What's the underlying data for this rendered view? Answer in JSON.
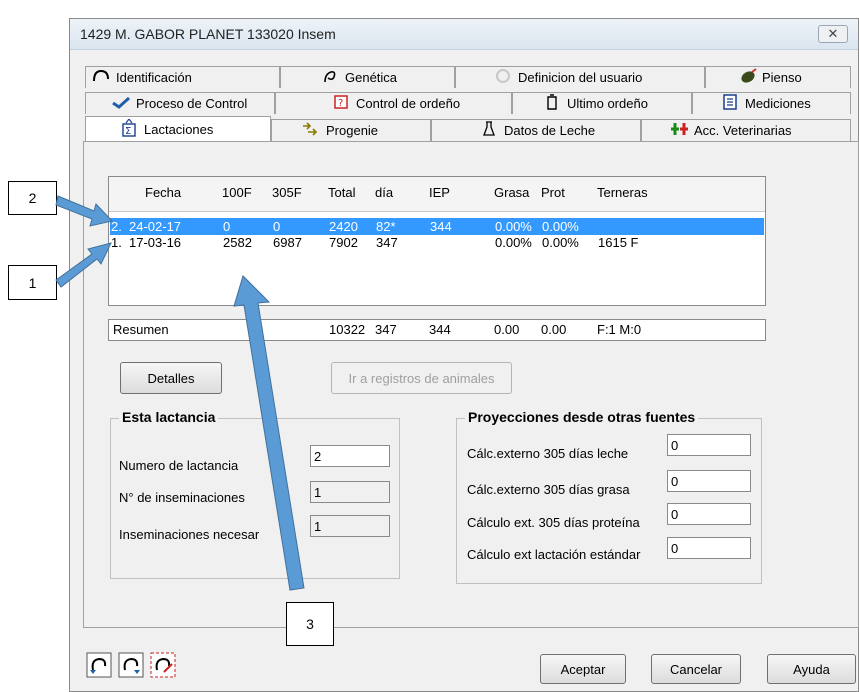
{
  "window": {
    "title": "1429  M. GABOR PLANET  133020  Insem",
    "close_label": "✕"
  },
  "tabs": {
    "row1": [
      {
        "label": "Identificación",
        "icon": "identification-icon"
      },
      {
        "label": "Genética",
        "icon": "genetics-icon"
      },
      {
        "label": "Definicion del usuario",
        "icon": "user-definition-icon"
      },
      {
        "label": "Pienso",
        "icon": "feed-icon"
      }
    ],
    "row2": [
      {
        "label": "Proceso de Control",
        "icon": "control-process-icon"
      },
      {
        "label": "Control de ordeño",
        "icon": "milking-control-icon"
      },
      {
        "label": "Ultimo ordeño",
        "icon": "last-milking-icon"
      },
      {
        "label": "Mediciones",
        "icon": "measurements-icon"
      }
    ],
    "row3": [
      {
        "label": "Lactaciones",
        "icon": "lactations-icon",
        "active": true
      },
      {
        "label": "Progenie",
        "icon": "progeny-icon"
      },
      {
        "label": "Datos de Leche",
        "icon": "milk-data-icon"
      },
      {
        "label": "Acc. Veterinarias",
        "icon": "veterinary-icon"
      }
    ]
  },
  "lactation_list": {
    "columns": [
      "Fecha",
      "100F",
      "305F",
      "Total",
      "día",
      "IEP",
      "Grasa",
      "Prot",
      "Terneras"
    ],
    "rows": [
      {
        "num": "2.",
        "fecha": "24-02-17",
        "f100": "0",
        "f305": "0",
        "total": "2420",
        "dia": "82*",
        "iep": "344",
        "grasa": "0.00%",
        "prot": "0.00%",
        "terneras": "",
        "selected": true
      },
      {
        "num": "1.",
        "fecha": "17-03-16",
        "f100": "2582",
        "f305": "6987",
        "total": "7902",
        "dia": "347",
        "iep": "",
        "grasa": "0.00%",
        "prot": "0.00%",
        "terneras": "1615 F",
        "selected": false
      }
    ],
    "summary": {
      "label": "Resumen",
      "total": "10322",
      "dia": "347",
      "iep": "344",
      "grasa": "0.00",
      "prot": "0.00",
      "terneras": "F:1  M:0"
    }
  },
  "buttons": {
    "details": "Detalles",
    "go_records": "Ir a registros de animales",
    "accept": "Aceptar",
    "cancel": "Cancelar",
    "help": "Ayuda"
  },
  "this_lactation": {
    "title": "Esta lactancia",
    "fields": [
      {
        "label": "Numero de lactancia",
        "value": "2"
      },
      {
        "label": "N° de inseminaciones",
        "value": "1"
      },
      {
        "label": "Inseminaciones necesar",
        "value": "1"
      }
    ]
  },
  "projections": {
    "title": "Proyecciones  desde otras fuentes",
    "fields": [
      {
        "label": "Cálc.externo 305 días leche",
        "value": "0"
      },
      {
        "label": "Cálc.externo 305 días grasa",
        "value": "0"
      },
      {
        "label": "Cálculo ext. 305 días proteína",
        "value": "0"
      },
      {
        "label": "Cálculo ext lactación estándar",
        "value": "0"
      }
    ]
  },
  "toolbar": [
    "navigate-back-icon",
    "navigate-forward-icon",
    "edit-icon"
  ],
  "callouts": [
    "1",
    "2",
    "3"
  ],
  "colors": {
    "selection": "#3399ff",
    "arrow": "#5b9bd5"
  }
}
